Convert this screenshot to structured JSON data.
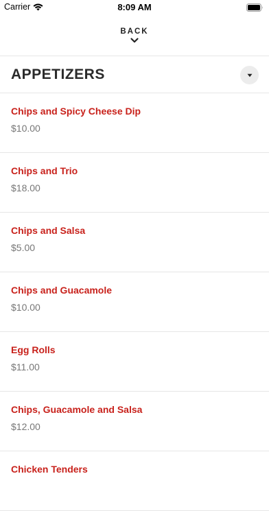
{
  "status_bar": {
    "carrier": "Carrier",
    "time": "8:09 AM"
  },
  "nav": {
    "back_label": "BACK"
  },
  "section": {
    "title": "APPETIZERS"
  },
  "menu_items": [
    {
      "name": "Chips and Spicy Cheese Dip",
      "price": "$10.00"
    },
    {
      "name": "Chips and Trio",
      "price": "$18.00"
    },
    {
      "name": "Chips and Salsa",
      "price": "$5.00"
    },
    {
      "name": "Chips and Guacamole",
      "price": "$10.00"
    },
    {
      "name": "Egg Rolls",
      "price": "$11.00"
    },
    {
      "name": "Chips, Guacamole and Salsa",
      "price": "$12.00"
    },
    {
      "name": "Chicken Tenders",
      "price": ""
    }
  ],
  "colors": {
    "item_name": "#c8211b",
    "price": "#777777",
    "divider": "#e6e6e6"
  },
  "icons": {
    "wifi": "wifi-icon",
    "battery": "battery-icon",
    "back": "chevron-down-icon",
    "dropdown": "caret-down-icon"
  }
}
